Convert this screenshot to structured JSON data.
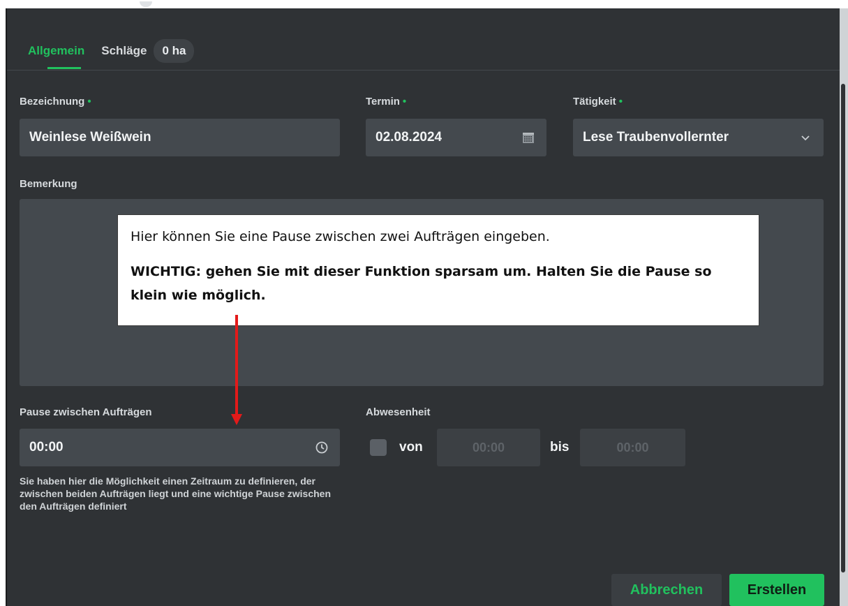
{
  "tabs": [
    {
      "label": "Allgemein",
      "active": true
    },
    {
      "label": "Schläge",
      "active": false
    }
  ],
  "badge": "0 ha",
  "fields": {
    "bezeichnung": {
      "label": "Bezeichnung",
      "required_mark": "•",
      "value": "Weinlese Weißwein"
    },
    "termin": {
      "label": "Termin",
      "required_mark": "•",
      "value": "02.08.2024",
      "icon": "calendar-icon"
    },
    "taetigkeit": {
      "label": "Tätigkeit",
      "required_mark": "•",
      "value": "Lese Traubenvollernter",
      "icon": "chevron-down-icon"
    },
    "bemerkung": {
      "label": "Bemerkung",
      "value": ""
    },
    "pause": {
      "label": "Pause zwischen Aufträgen",
      "value": "00:00",
      "icon": "clock-icon",
      "hint": "Sie haben hier die Möglichkeit einen Zeitraum zu definieren, der zwischen beiden Aufträgen liegt und eine wichtige Pause zwischen den Aufträgen definiert"
    },
    "abwesenheit": {
      "label": "Abwesenheit",
      "checked": false,
      "von_label": "von",
      "von_value": "00:00",
      "bis_label": "bis",
      "bis_value": "00:00"
    }
  },
  "callout": {
    "text": "Hier können Sie eine Pause zwischen zwei Aufträgen eingeben.",
    "warning": "WICHTIG: gehen Sie mit dieser Funktion sparsam um. Halten Sie die Pause so klein wie möglich."
  },
  "buttons": {
    "cancel": "Abbrechen",
    "create": "Erstellen"
  },
  "colors": {
    "accent": "#21c15e",
    "background": "#2f3235",
    "field": "#44494e",
    "arrow": "#e31a1a"
  }
}
